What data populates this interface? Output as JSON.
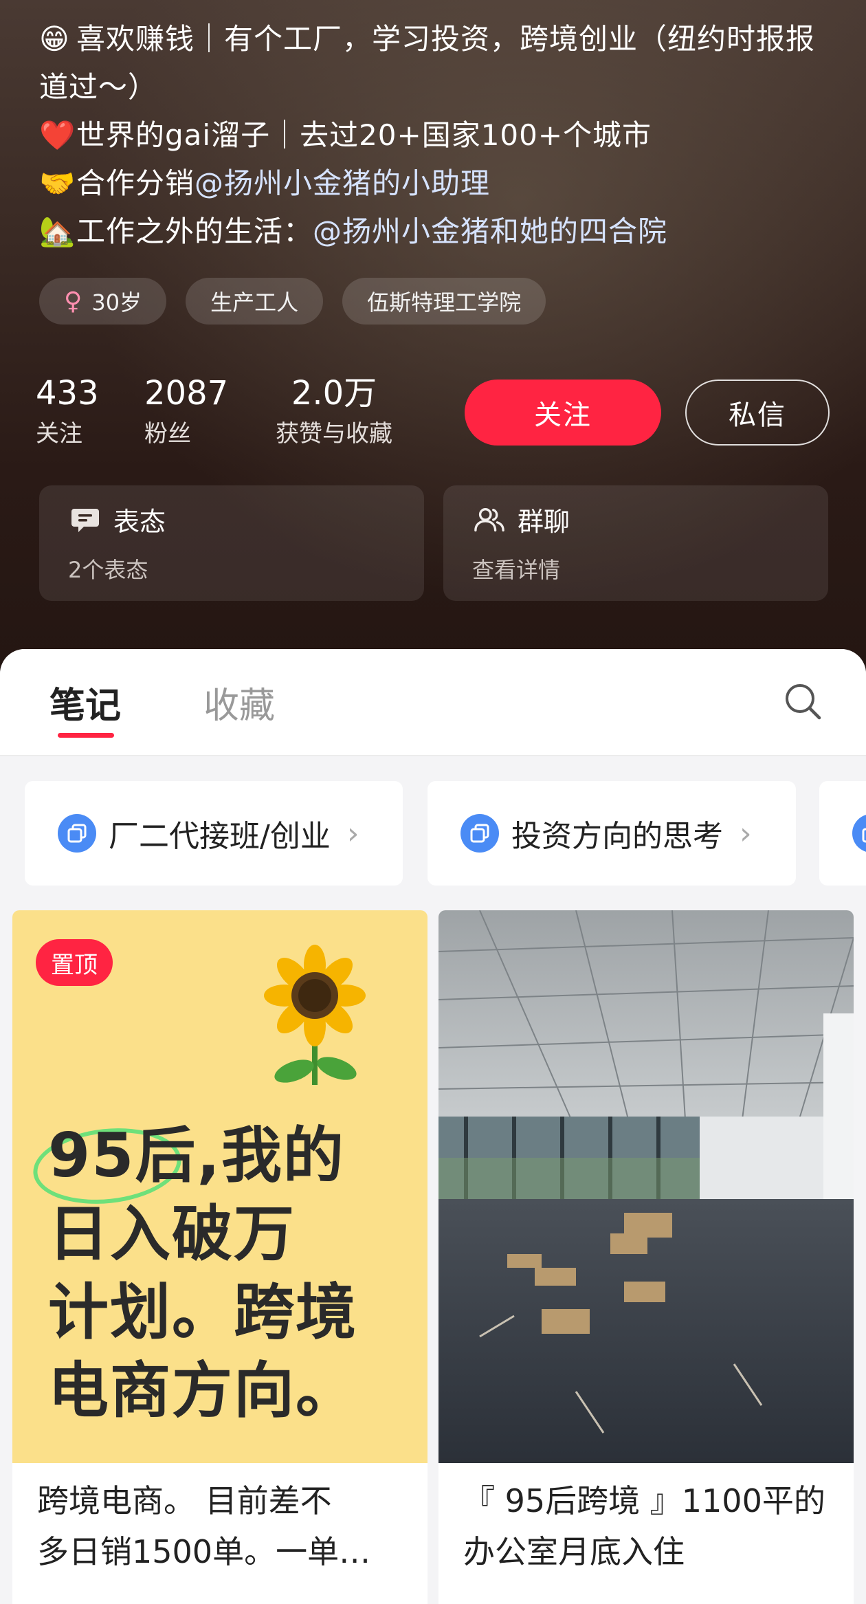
{
  "profile": {
    "bio": {
      "line1_emoji": "😁",
      "line1_text": "喜欢赚钱｜有个工厂，学习投资，跨境创业（纽约时报报道过～）",
      "line2_emoji": "❤️",
      "line2_text": "世界的gai溜子｜去过20+国家100+个城市",
      "line3_emoji": "🤝",
      "line3_prefix": "合作分销",
      "line3_mention": "@扬州小金猪的小助理",
      "line4_emoji": "🏡",
      "line4_prefix": "工作之外的生活：",
      "line4_mention": "@扬州小金猪和她的四合院"
    },
    "tags": {
      "age": "30岁",
      "job": "生产工人",
      "school": "伍斯特理工学院"
    },
    "stats": {
      "following_num": "433",
      "following_label": "关注",
      "followers_num": "2087",
      "followers_label": "粉丝",
      "likes_num": "2.0万",
      "likes_label": "获赞与收藏"
    },
    "buttons": {
      "follow": "关注",
      "message": "私信"
    },
    "cards": {
      "reactions_title": "表态",
      "reactions_sub": "2个表态",
      "group_title": "群聊",
      "group_sub": "查看详情"
    }
  },
  "content": {
    "tabs": {
      "notes": "笔记",
      "collections": "收藏"
    },
    "collections": [
      {
        "label": "厂二代接班/创业"
      },
      {
        "label": "投资方向的思考"
      }
    ],
    "notes": [
      {
        "pin_label": "置顶",
        "cover_lines": [
          "95后,我的",
          "日入破万",
          "计划。跨境",
          "电商方向。"
        ],
        "title_line1": "跨境电商。 目前差不",
        "title_line2": "多日销1500单。一单…"
      },
      {
        "title_line1": "『 95后跨境 』1100平的",
        "title_line2": "办公室月底入住"
      }
    ]
  },
  "colors": {
    "accent": "#ff2442",
    "collection_icon": "#4a8bf5",
    "cover_yellow": "#fbe08a"
  }
}
